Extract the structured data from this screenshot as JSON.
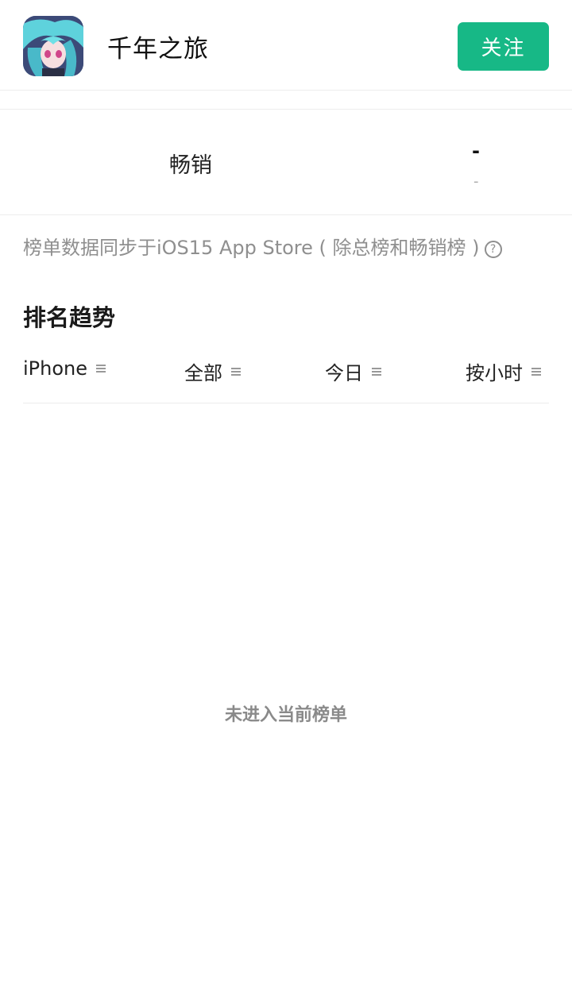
{
  "header": {
    "app_name": "千年之旅",
    "follow_label": "关注"
  },
  "rank": {
    "label": "畅销",
    "value": "-",
    "change": "-"
  },
  "note": {
    "text": "榜单数据同步于iOS15 App Store ( 除总榜和畅销榜 )"
  },
  "section": {
    "title": "排名趋势"
  },
  "filters": [
    {
      "label": "iPhone"
    },
    {
      "label": "全部"
    },
    {
      "label": "今日"
    },
    {
      "label": "按小时"
    }
  ],
  "empty_state": {
    "text": "未进入当前榜单"
  },
  "icons": {
    "menu": "menu-lines-icon",
    "help": "question-circle-icon"
  },
  "colors": {
    "accent": "#17b886"
  }
}
